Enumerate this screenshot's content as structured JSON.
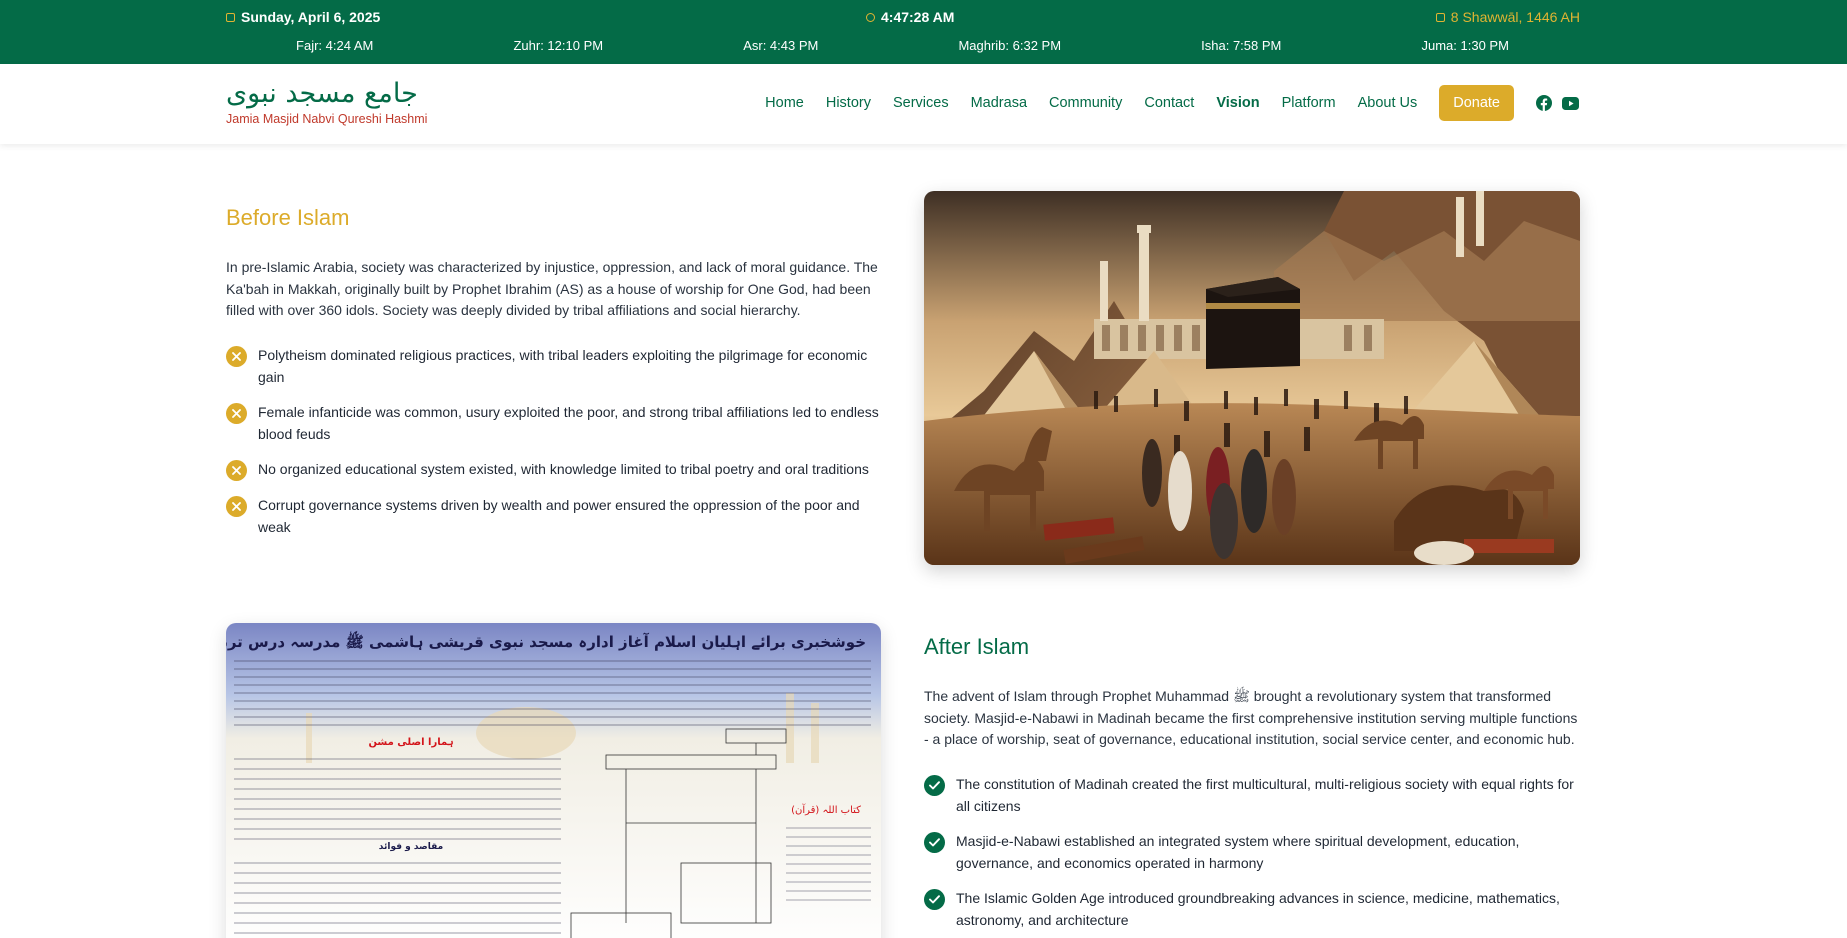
{
  "topbar": {
    "date": "Sunday, April 6, 2025",
    "time": "4:47:28 AM",
    "hijri": "8 Shawwāl, 1446 AH",
    "prayers": [
      {
        "label": "Fajr: 4:24 AM"
      },
      {
        "label": "Zuhr: 12:10 PM"
      },
      {
        "label": "Asr: 4:43 PM"
      },
      {
        "label": "Maghrib: 6:32 PM"
      },
      {
        "label": "Isha: 7:58 PM"
      },
      {
        "label": "Juma: 1:30 PM"
      }
    ]
  },
  "brand": {
    "urdu": "جامع مسجد نبوی",
    "english": "Jamia Masjid Nabvi Qureshi Hashmi"
  },
  "nav": {
    "items": [
      {
        "label": "Home"
      },
      {
        "label": "History"
      },
      {
        "label": "Services"
      },
      {
        "label": "Madrasa"
      },
      {
        "label": "Community"
      },
      {
        "label": "Contact"
      },
      {
        "label": "Vision"
      },
      {
        "label": "Platform"
      },
      {
        "label": "About Us"
      }
    ],
    "active": "Vision",
    "donate": "Donate",
    "social_icons": [
      "facebook-icon",
      "youtube-icon"
    ]
  },
  "before": {
    "title": "Before Islam",
    "paragraph": "In pre-Islamic Arabia, society was characterized by injustice, oppression, and lack of moral guidance. The Ka'bah in Makkah, originally built by Prophet Ibrahim (AS) as a house of worship for One God, had been filled with over 360 idols. Society was deeply divided by tribal affiliations and social hierarchy.",
    "points": [
      {
        "text": "Polytheism dominated religious practices, with tribal leaders exploiting the pilgrimage for economic gain"
      },
      {
        "text": "Female infanticide was common, usury exploited the poor, and strong tribal affiliations led to endless blood feuds"
      },
      {
        "text": "No organized educational system existed, with knowledge limited to tribal poetry and oral traditions"
      },
      {
        "text": "Corrupt governance systems driven by wealth and power ensured the oppression of the poor and weak"
      }
    ]
  },
  "after": {
    "title": "After Islam",
    "paragraph": "The advent of Islam through Prophet Muhammad ﷺ brought a revolutionary system that transformed society. Masjid-e-Nabawi in Madinah became the first comprehensive institution serving multiple functions - a place of worship, seat of governance, educational institution, social service center, and economic hub.",
    "points": [
      {
        "text": "The constitution of Madinah created the first multicultural, multi-religious society with equal rights for all citizens"
      },
      {
        "text": "Masjid-e-Nabawi established an integrated system where spiritual development, education, governance, and economics operated in harmony"
      },
      {
        "text": "The Islamic Golden Age introduced groundbreaking advances in science, medicine, mathematics, astronomy, and architecture"
      }
    ]
  },
  "poster": {
    "headline": "خوشخبری برائے اہلیان اسلام آغاز ادارہ مسجد نبوی قریشی ہاشمی ﷺ مدرسہ درس تربیت نبوی اسلام آباد پاکستان",
    "mission_label": "ہمارا اصلی مشن",
    "purpose_label": "مقاصد و فوائد",
    "book_label": "کتاب اللہ (قرآن)"
  },
  "colors": {
    "primary_green": "#046b47",
    "gold": "#dcab2a",
    "brand_red": "#c0392b"
  }
}
